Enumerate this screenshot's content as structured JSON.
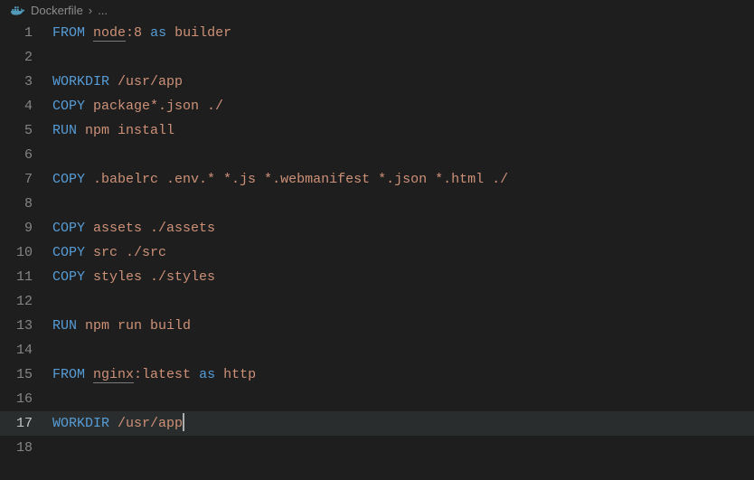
{
  "breadcrumb": {
    "file": "Dockerfile",
    "rest": "..."
  },
  "lines": [
    {
      "n": 1,
      "tokens": [
        {
          "t": "FROM",
          "c": "kw"
        },
        {
          "t": " "
        },
        {
          "t": "node",
          "c": "txt underline"
        },
        {
          "t": ":8",
          "c": "txt"
        },
        {
          "t": " "
        },
        {
          "t": "as",
          "c": "kw"
        },
        {
          "t": " "
        },
        {
          "t": "builder",
          "c": "txt"
        }
      ]
    },
    {
      "n": 2,
      "tokens": []
    },
    {
      "n": 3,
      "tokens": [
        {
          "t": "WORKDIR",
          "c": "kw"
        },
        {
          "t": " "
        },
        {
          "t": "/usr/app",
          "c": "txt"
        }
      ]
    },
    {
      "n": 4,
      "tokens": [
        {
          "t": "COPY",
          "c": "kw"
        },
        {
          "t": " "
        },
        {
          "t": "package*.json ./",
          "c": "txt"
        }
      ]
    },
    {
      "n": 5,
      "tokens": [
        {
          "t": "RUN",
          "c": "kw"
        },
        {
          "t": " "
        },
        {
          "t": "npm install",
          "c": "txt"
        }
      ]
    },
    {
      "n": 6,
      "tokens": []
    },
    {
      "n": 7,
      "tokens": [
        {
          "t": "COPY",
          "c": "kw"
        },
        {
          "t": " "
        },
        {
          "t": ".babelrc .env.* *.js *.webmanifest *.json *.html ./",
          "c": "txt"
        }
      ]
    },
    {
      "n": 8,
      "tokens": []
    },
    {
      "n": 9,
      "tokens": [
        {
          "t": "COPY",
          "c": "kw"
        },
        {
          "t": " "
        },
        {
          "t": "assets ./assets",
          "c": "txt"
        }
      ]
    },
    {
      "n": 10,
      "tokens": [
        {
          "t": "COPY",
          "c": "kw"
        },
        {
          "t": " "
        },
        {
          "t": "src ./src",
          "c": "txt"
        }
      ]
    },
    {
      "n": 11,
      "tokens": [
        {
          "t": "COPY",
          "c": "kw"
        },
        {
          "t": " "
        },
        {
          "t": "styles ./styles",
          "c": "txt"
        }
      ]
    },
    {
      "n": 12,
      "tokens": []
    },
    {
      "n": 13,
      "tokens": [
        {
          "t": "RUN",
          "c": "kw"
        },
        {
          "t": " "
        },
        {
          "t": "npm run build",
          "c": "txt"
        }
      ]
    },
    {
      "n": 14,
      "tokens": []
    },
    {
      "n": 15,
      "tokens": [
        {
          "t": "FROM",
          "c": "kw"
        },
        {
          "t": " "
        },
        {
          "t": "nginx",
          "c": "txt underline"
        },
        {
          "t": ":latest",
          "c": "txt"
        },
        {
          "t": " "
        },
        {
          "t": "as",
          "c": "kw"
        },
        {
          "t": " "
        },
        {
          "t": "http",
          "c": "txt"
        }
      ]
    },
    {
      "n": 16,
      "tokens": []
    },
    {
      "n": 17,
      "active": true,
      "cursor": true,
      "tokens": [
        {
          "t": "WORKDIR",
          "c": "kw"
        },
        {
          "t": " "
        },
        {
          "t": "/usr/app",
          "c": "txt"
        }
      ]
    },
    {
      "n": 18,
      "tokens": []
    }
  ]
}
